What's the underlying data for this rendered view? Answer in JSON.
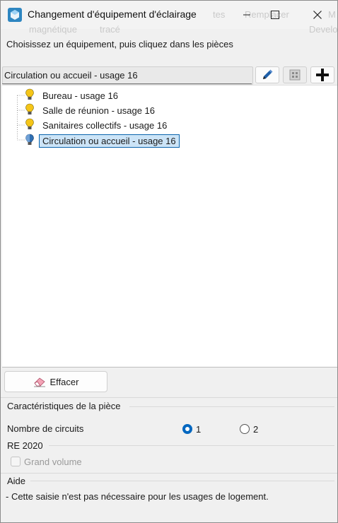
{
  "window": {
    "title": "Changement d'équipement d'éclairage",
    "minimize": "minimize",
    "maximize": "maximize",
    "close": "close",
    "background_ghost": [
      "tes",
      "Remplacer",
      "M",
      "magnétique",
      "tracé",
      "Develo"
    ]
  },
  "instruction": "Choisissez un équipement, puis cliquez dans les pièces",
  "selector": {
    "current": "Circulation ou accueil - usage 16",
    "buttons": [
      "pencil-icon",
      "grid-icon",
      "plus-icon"
    ]
  },
  "tree": {
    "items": [
      {
        "label": "Bureau - usage 16",
        "icon": "lightbulb-yellow-icon",
        "selected": false
      },
      {
        "label": "Salle de réunion - usage 16",
        "icon": "lightbulb-yellow-icon",
        "selected": false
      },
      {
        "label": "Sanitaires collectifs - usage 16",
        "icon": "lightbulb-yellow-icon",
        "selected": false
      },
      {
        "label": "Circulation ou accueil - usage 16",
        "icon": "lightbulb-blue-icon",
        "selected": true
      }
    ]
  },
  "erase_button": {
    "label": "Effacer",
    "icon": "eraser-icon"
  },
  "room": {
    "title": "Caractéristiques de la pièce",
    "circuits_label": "Nombre de circuits",
    "circuit_options": [
      {
        "label": "1",
        "selected": true
      },
      {
        "label": "2",
        "selected": false
      }
    ]
  },
  "re2020": {
    "title": "RE 2020",
    "grand_volume_label": "Grand volume",
    "grand_volume_checked": false,
    "enabled": false
  },
  "help": {
    "title": "Aide",
    "text": "- Cette saisie n'est pas nécessaire pour les usages de logement."
  },
  "colors": {
    "accent": "#0067c0",
    "selection_bg": "#cce4f7",
    "selection_border": "#0a64ad",
    "bulb_yellow": "#f5c518",
    "bulb_blue": "#2f6fb3"
  }
}
